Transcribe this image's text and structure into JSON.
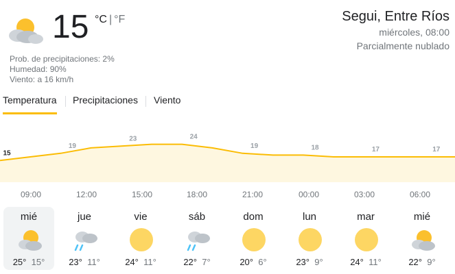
{
  "current": {
    "temperature": "15",
    "unit_c": "°C",
    "unit_sep": "|",
    "unit_f": "°F",
    "icon": "partly-cloudy-icon",
    "precip": "Prob. de precipitaciones: 2%",
    "humidity": "Humedad: 90%",
    "wind": "Viento: a 16 km/h"
  },
  "location": {
    "name": "Segui, Entre Ríos",
    "time": "miércoles, 08:00",
    "condition": "Parcialmente nublado"
  },
  "tabs": [
    {
      "label": "Temperatura",
      "active": true
    },
    {
      "label": "Precipitaciones",
      "active": false
    },
    {
      "label": "Viento",
      "active": false
    }
  ],
  "chart_data": {
    "type": "area",
    "series": [
      {
        "values": [
          15,
          17,
          19,
          22,
          23,
          24,
          24,
          22,
          19,
          18,
          18,
          17,
          17,
          17,
          17,
          17
        ]
      }
    ],
    "labeled_points": [
      15,
      19,
      23,
      24,
      19,
      18,
      17,
      17
    ],
    "x": [
      "09:00",
      "12:00",
      "15:00",
      "18:00",
      "21:00",
      "00:00",
      "03:00",
      "06:00"
    ],
    "color_line": "#fbbc04",
    "color_fill": "#fef7e0"
  },
  "forecast": [
    {
      "day": "mié",
      "icon": "partly-cloudy-icon",
      "high": "25°",
      "low": "15°",
      "selected": true
    },
    {
      "day": "jue",
      "icon": "rain-cloud-icon",
      "high": "23°",
      "low": "11°",
      "selected": false
    },
    {
      "day": "vie",
      "icon": "sun-icon",
      "high": "24°",
      "low": "11°",
      "selected": false
    },
    {
      "day": "sáb",
      "icon": "rain-cloud-icon",
      "high": "22°",
      "low": "7°",
      "selected": false
    },
    {
      "day": "dom",
      "icon": "sun-icon",
      "high": "20°",
      "low": "6°",
      "selected": false
    },
    {
      "day": "lun",
      "icon": "sun-icon",
      "high": "23°",
      "low": "9°",
      "selected": false
    },
    {
      "day": "mar",
      "icon": "sun-icon",
      "high": "24°",
      "low": "11°",
      "selected": false
    },
    {
      "day": "mié",
      "icon": "partly-cloudy-icon",
      "high": "22°",
      "low": "9°",
      "selected": false
    }
  ]
}
